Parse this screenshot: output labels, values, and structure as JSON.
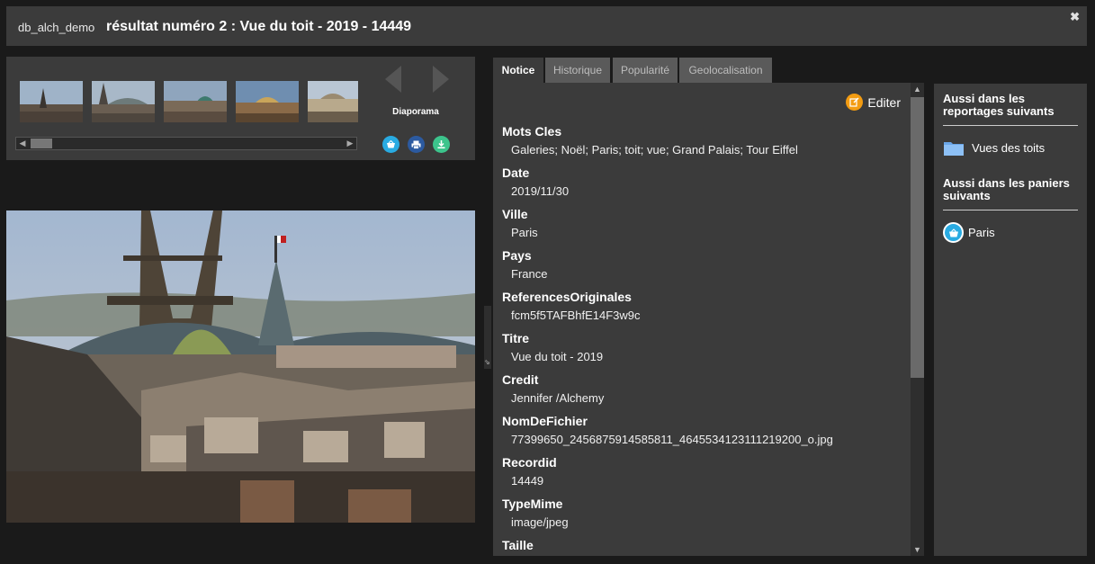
{
  "header": {
    "db_name": "db_alch_demo",
    "title": "résultat numéro 2 : Vue du toit  - 2019 - 14449",
    "close_icon": "close-icon"
  },
  "thumbnails": {
    "items": [
      "thumb-1",
      "thumb-2",
      "thumb-3",
      "thumb-4",
      "thumb-5"
    ],
    "selected_index": 1,
    "slideshow_label": "Diaporama",
    "actions": [
      {
        "name": "basket-icon",
        "color": "#29abe2"
      },
      {
        "name": "print-icon",
        "color": "#2c5aa0"
      },
      {
        "name": "download-icon",
        "color": "#3cc48c"
      }
    ]
  },
  "tabs": [
    {
      "label": "Notice",
      "active": true
    },
    {
      "label": "Historique",
      "active": false
    },
    {
      "label": "Popularité",
      "active": false
    },
    {
      "label": "Geolocalisation",
      "active": false
    }
  ],
  "notice": {
    "edit_label": "Editer",
    "fields": [
      {
        "label": "Mots Cles",
        "value": "Galeries; Noël; Paris; toit; vue; Grand Palais; Tour Eiffel"
      },
      {
        "label": "Date",
        "value": "2019/11/30"
      },
      {
        "label": "Ville",
        "value": "Paris"
      },
      {
        "label": "Pays",
        "value": "France"
      },
      {
        "label": "ReferencesOriginales",
        "value": "fcm5f5TAFBhfE14F3w9c"
      },
      {
        "label": "Titre",
        "value": "Vue du toit  - 2019"
      },
      {
        "label": "Credit",
        "value": "Jennifer  /Alchemy"
      },
      {
        "label": "NomDeFichier",
        "value": "77399650_2456875914585811_4645534123111219200_o.jpg"
      },
      {
        "label": "Recordid",
        "value": "14449"
      },
      {
        "label": "TypeMime",
        "value": "image/jpeg"
      },
      {
        "label": "Taille",
        "value": ""
      }
    ]
  },
  "side": {
    "reportages_heading": "Aussi dans les reportages suivants",
    "reportages": [
      {
        "label": "Vues des toits",
        "icon": "folder-icon"
      }
    ],
    "paniers_heading": "Aussi dans les paniers suivants",
    "paniers": [
      {
        "label": "Paris",
        "icon": "basket-icon"
      }
    ]
  },
  "colors": {
    "panel": "#3b3b3b",
    "background": "#1a1a1a",
    "edit_accent": "#f39c12",
    "basket_accent": "#29abe2"
  }
}
